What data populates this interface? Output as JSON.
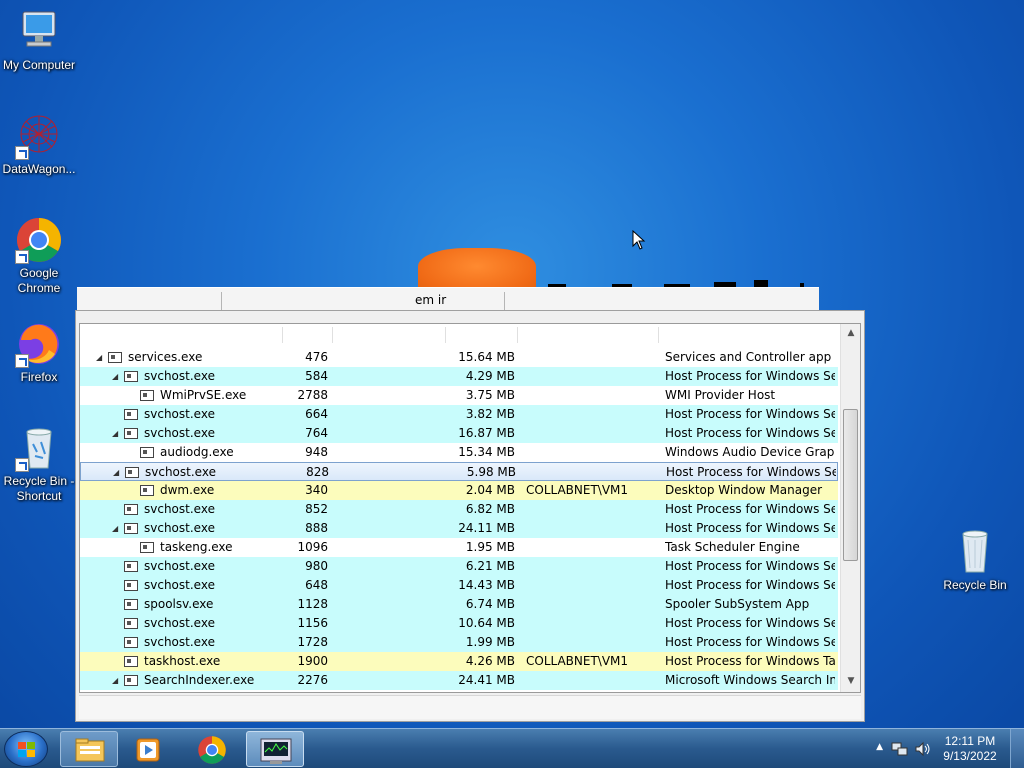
{
  "desktop": {
    "icons": [
      {
        "label": "My Computer",
        "icon": "computer-icon"
      },
      {
        "label": "DataWagon...",
        "icon": "datawagon-icon"
      },
      {
        "label": "Google Chrome",
        "icon": "chrome-icon"
      },
      {
        "label": "Firefox",
        "icon": "firefox-icon"
      },
      {
        "label": "Recycle Bin - Shortcut",
        "icon": "recycle-bin-icon"
      },
      {
        "label": "Recycle Bin",
        "icon": "recycle-bin-icon"
      }
    ]
  },
  "taskmanager": {
    "header_fragment": "em ir",
    "rows": [
      {
        "name": "services.exe",
        "pid": "476",
        "mem": "15.64 MB",
        "user": "",
        "desc": "Services and Controller app",
        "indent": 0,
        "expander": "◢",
        "color": "white"
      },
      {
        "name": "svchost.exe",
        "pid": "584",
        "mem": "4.29 MB",
        "user": "",
        "desc": "Host Process for Windows Ser...",
        "indent": 1,
        "expander": "◢",
        "color": "cyan"
      },
      {
        "name": "WmiPrvSE.exe",
        "pid": "2788",
        "mem": "3.75 MB",
        "user": "",
        "desc": "WMI Provider Host",
        "indent": 2,
        "expander": "",
        "color": "white"
      },
      {
        "name": "svchost.exe",
        "pid": "664",
        "mem": "3.82 MB",
        "user": "",
        "desc": "Host Process for Windows Ser...",
        "indent": 1,
        "expander": "",
        "color": "cyan"
      },
      {
        "name": "svchost.exe",
        "pid": "764",
        "mem": "16.87 MB",
        "user": "",
        "desc": "Host Process for Windows Ser...",
        "indent": 1,
        "expander": "◢",
        "color": "cyan"
      },
      {
        "name": "audiodg.exe",
        "pid": "948",
        "mem": "15.34 MB",
        "user": "",
        "desc": "Windows Audio Device Graph...",
        "indent": 2,
        "expander": "",
        "color": "white"
      },
      {
        "name": "svchost.exe",
        "pid": "828",
        "mem": "5.98 MB",
        "user": "",
        "desc": "Host Process for Windows Ser...",
        "indent": 1,
        "expander": "◢",
        "color": "selected"
      },
      {
        "name": "dwm.exe",
        "pid": "340",
        "mem": "2.04 MB",
        "user": "COLLABNET\\VM1",
        "desc": "Desktop Window Manager",
        "indent": 2,
        "expander": "",
        "color": "yellow"
      },
      {
        "name": "svchost.exe",
        "pid": "852",
        "mem": "6.82 MB",
        "user": "",
        "desc": "Host Process for Windows Ser...",
        "indent": 1,
        "expander": "",
        "color": "cyan"
      },
      {
        "name": "svchost.exe",
        "pid": "888",
        "mem": "24.11 MB",
        "user": "",
        "desc": "Host Process for Windows Ser...",
        "indent": 1,
        "expander": "◢",
        "color": "cyan"
      },
      {
        "name": "taskeng.exe",
        "pid": "1096",
        "mem": "1.95 MB",
        "user": "",
        "desc": "Task Scheduler Engine",
        "indent": 2,
        "expander": "",
        "color": "white"
      },
      {
        "name": "svchost.exe",
        "pid": "980",
        "mem": "6.21 MB",
        "user": "",
        "desc": "Host Process for Windows Ser...",
        "indent": 1,
        "expander": "",
        "color": "cyan"
      },
      {
        "name": "svchost.exe",
        "pid": "648",
        "mem": "14.43 MB",
        "user": "",
        "desc": "Host Process for Windows Ser...",
        "indent": 1,
        "expander": "",
        "color": "cyan"
      },
      {
        "name": "spoolsv.exe",
        "pid": "1128",
        "mem": "6.74 MB",
        "user": "",
        "desc": "Spooler SubSystem App",
        "indent": 1,
        "expander": "",
        "color": "cyan"
      },
      {
        "name": "svchost.exe",
        "pid": "1156",
        "mem": "10.64 MB",
        "user": "",
        "desc": "Host Process for Windows Ser...",
        "indent": 1,
        "expander": "",
        "color": "cyan"
      },
      {
        "name": "svchost.exe",
        "pid": "1728",
        "mem": "1.99 MB",
        "user": "",
        "desc": "Host Process for Windows Ser...",
        "indent": 1,
        "expander": "",
        "color": "cyan"
      },
      {
        "name": "taskhost.exe",
        "pid": "1900",
        "mem": "4.26 MB",
        "user": "COLLABNET\\VM1",
        "desc": "Host Process for Windows Tas...",
        "indent": 1,
        "expander": "",
        "color": "yellow"
      },
      {
        "name": "SearchIndexer.exe",
        "pid": "2276",
        "mem": "24.41 MB",
        "user": "",
        "desc": "Microsoft Windows Search In...",
        "indent": 1,
        "expander": "◢",
        "color": "cyan"
      }
    ]
  },
  "taskbar": {
    "items": [
      {
        "icon": "explorer-icon",
        "active": false
      },
      {
        "icon": "media-player-icon",
        "active": false
      },
      {
        "icon": "chrome-icon",
        "active": false
      },
      {
        "icon": "task-manager-icon",
        "active": true
      }
    ],
    "time": "12:11 PM",
    "date": "9/13/2022"
  },
  "colors": {
    "row_cyan": "#c8fcfc",
    "row_yellow": "#fcfcbc",
    "desktop_blue": "#1a6fd0"
  }
}
